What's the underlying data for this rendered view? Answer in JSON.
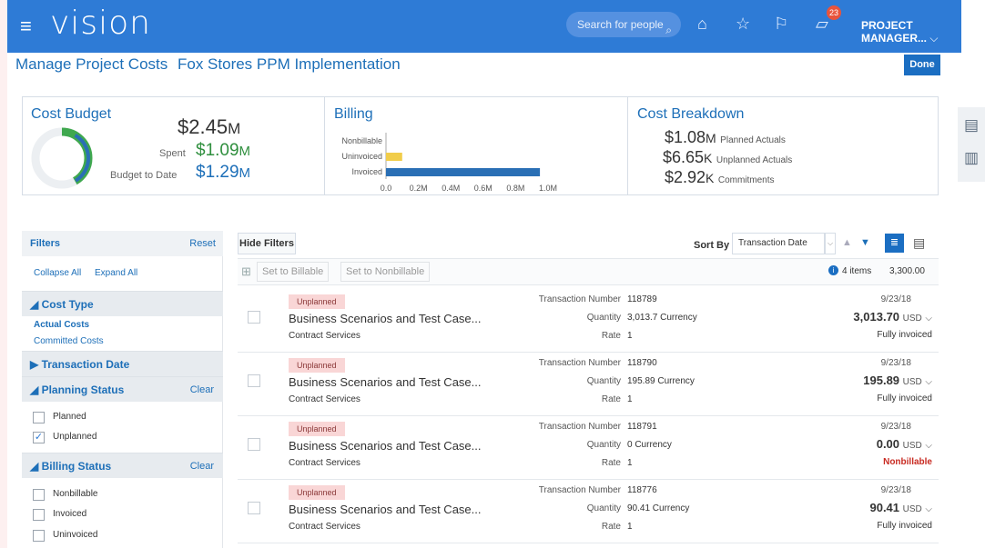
{
  "header": {
    "brand": "vision",
    "search_placeholder": "Search for people",
    "notifications": "23",
    "user": "PROJECT MANAGER..."
  },
  "page": {
    "title_a": "Manage Project Costs",
    "title_b": "Fox Stores PPM Implementation",
    "done": "Done"
  },
  "cost_budget": {
    "title": "Cost Budget",
    "total": "$2.45",
    "total_unit": "M",
    "spent_label": "Spent",
    "spent": "$1.09",
    "spent_unit": "M",
    "btd_label": "Budget to Date",
    "btd": "$1.29",
    "btd_unit": "M"
  },
  "billing": {
    "title": "Billing",
    "chart_data": {
      "type": "bar",
      "orientation": "horizontal",
      "categories": [
        "Nonbillable",
        "Uninvoiced",
        "Invoiced"
      ],
      "values": [
        0,
        0.1,
        0.95
      ],
      "colors": [
        "#e8c63a",
        "#f1cd4a",
        "#2a6fb5"
      ],
      "ticks": [
        "0.0",
        "0.2M",
        "0.4M",
        "0.6M",
        "0.8M",
        "1.0M"
      ],
      "xlim": [
        0,
        1.0
      ]
    }
  },
  "cost_breakdown": {
    "title": "Cost Breakdown",
    "items": [
      {
        "value": "$1.08",
        "unit": "M",
        "label": "Planned Actuals"
      },
      {
        "value": "$6.65",
        "unit": "K",
        "label": "Unplanned Actuals"
      },
      {
        "value": "$2.92",
        "unit": "K",
        "label": "Commitments"
      }
    ]
  },
  "filters": {
    "title": "Filters",
    "reset": "Reset",
    "collapse": "Collapse All",
    "expand": "Expand All",
    "cost_type": {
      "label": "Cost Type",
      "items": [
        "Actual Costs",
        "Committed Costs"
      ]
    },
    "transaction_date": {
      "label": "Transaction Date"
    },
    "planning_status": {
      "label": "Planning Status",
      "clear": "Clear",
      "items": [
        {
          "label": "Planned",
          "checked": false
        },
        {
          "label": "Unplanned",
          "checked": true
        }
      ]
    },
    "billing_status": {
      "label": "Billing Status",
      "clear": "Clear",
      "items": [
        {
          "label": "Nonbillable",
          "checked": false
        },
        {
          "label": "Invoiced",
          "checked": false
        },
        {
          "label": "Uninvoiced",
          "checked": false
        }
      ]
    }
  },
  "toolbar": {
    "hide_filters": "Hide Filters",
    "sort_by": "Sort By",
    "sort_value": "Transaction Date",
    "set_billable": "Set to Billable",
    "set_nonbillable": "Set to Nonbillable",
    "items_count": "4 items",
    "total": "3,300.00"
  },
  "labels": {
    "txn": "Transaction Number",
    "qty": "Quantity",
    "rate": "Rate"
  },
  "rows": [
    {
      "tag": "Unplanned",
      "title": "Business Scenarios and Test Case...",
      "sub": "Contract Services",
      "txn": "118789",
      "qty": "3,013.7 Currency",
      "rate": "1",
      "date": "9/23/18",
      "amount": "3,013.70",
      "currency": "USD",
      "status": "Fully invoiced"
    },
    {
      "tag": "Unplanned",
      "title": "Business Scenarios and Test Case...",
      "sub": "Contract Services",
      "txn": "118790",
      "qty": "195.89 Currency",
      "rate": "1",
      "date": "9/23/18",
      "amount": "195.89",
      "currency": "USD",
      "status": "Fully invoiced"
    },
    {
      "tag": "Unplanned",
      "title": "Business Scenarios and Test Case...",
      "sub": "Contract Services",
      "txn": "118791",
      "qty": "0 Currency",
      "rate": "1",
      "date": "9/23/18",
      "amount": "0.00",
      "currency": "USD",
      "status": "Nonbillable"
    },
    {
      "tag": "Unplanned",
      "title": "Business Scenarios and Test Case...",
      "sub": "Contract Services",
      "txn": "118776",
      "qty": "90.41 Currency",
      "rate": "1",
      "date": "9/23/18",
      "amount": "90.41",
      "currency": "USD",
      "status": "Fully invoiced"
    }
  ]
}
